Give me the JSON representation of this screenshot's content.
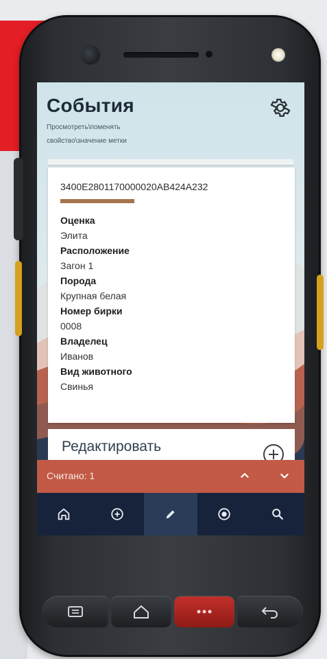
{
  "header": {
    "title": "События",
    "subtitle": "Просмотреть\\поменять свойство\\значение метки"
  },
  "tag": {
    "id": "3400E2801170000020AB424A232",
    "fields": [
      {
        "label": "Оценка",
        "value": "Элита"
      },
      {
        "label": "Расположение",
        "value": "Загон 1"
      },
      {
        "label": "Порода",
        "value": "Крупная белая"
      },
      {
        "label": "Номер бирки",
        "value": "0008"
      },
      {
        "label": "Владелец",
        "value": "Иванов"
      },
      {
        "label": "Вид животного",
        "value": "Свинья"
      }
    ]
  },
  "edit": {
    "title": "Редактировать"
  },
  "status": {
    "read_count_label": "Считано: 1"
  },
  "nav": {
    "items": [
      {
        "icon": "home-icon"
      },
      {
        "icon": "add-circle-icon"
      },
      {
        "icon": "pencil-icon",
        "active": true
      },
      {
        "icon": "rfid-scan-icon"
      },
      {
        "icon": "search-icon"
      }
    ]
  },
  "colors": {
    "accent_red": "#e31e25",
    "status_bar": "#c25a46",
    "nav_background": "#16233a",
    "tag_bar": "#a7744d"
  }
}
